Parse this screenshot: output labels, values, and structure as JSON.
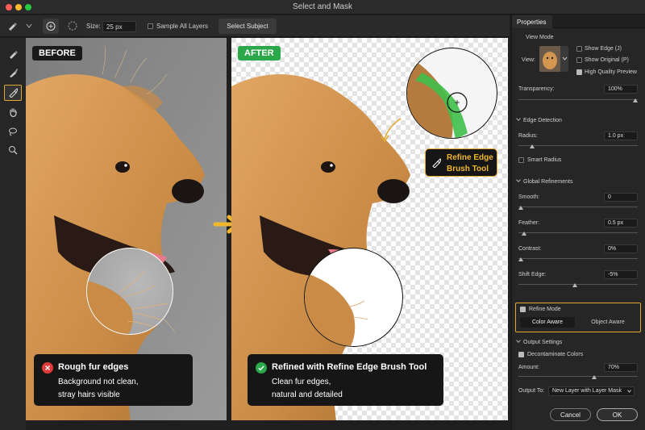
{
  "window": {
    "title": "Select and Mask"
  },
  "options": {
    "size_label": "Size:",
    "size_value": "25 px",
    "sample_all_layers": "Sample All Layers",
    "select_subject": "Select Subject"
  },
  "before": {
    "label": "BEFORE",
    "callout_title": "Rough fur edges",
    "callout_line1": "Background not clean,",
    "callout_line2": "stray hairs visible"
  },
  "after": {
    "label": "AFTER",
    "callout_title": "Refined with Refine Edge Brush Tool",
    "callout_line1": "Clean fur edges,",
    "callout_line2": "natural and detailed",
    "tool_tip_line1": "Refine Edge",
    "tool_tip_line2": "Brush Tool"
  },
  "properties": {
    "tab": "Properties",
    "view_mode": "View Mode",
    "view_label": "View:",
    "show_edge": "Show Edge (J)",
    "show_original": "Show Original (P)",
    "hq_preview": "High Quality Preview",
    "transparency_label": "Transparency:",
    "transparency_value": "100%",
    "edge_detection": "Edge Detection",
    "radius_label": "Radius:",
    "radius_value": "1.0 px",
    "smart_radius": "Smart Radius",
    "global_refinements": "Global Refinements",
    "smooth_label": "Smooth:",
    "smooth_value": "0",
    "feather_label": "Feather:",
    "feather_value": "0.5 px",
    "contrast_label": "Contrast:",
    "contrast_value": "0%",
    "shift_edge_label": "Shift Edge:",
    "shift_edge_value": "-5%",
    "refine_mode": "Refine Mode",
    "color_aware": "Color Aware",
    "object_aware": "Object Aware",
    "output_settings": "Output Settings",
    "decontaminate": "Decontaminate Colors",
    "amount_label": "Amount:",
    "amount_value": "70%",
    "output_to_label": "Output To:",
    "output_to_value": "New Layer with Layer Mask",
    "cancel": "Cancel",
    "ok": "OK"
  },
  "colors": {
    "accent": "#e2a92b",
    "before_label": "#1a1a1a",
    "after_label": "#2aa84a",
    "mask_green": "#3fbf4a"
  }
}
